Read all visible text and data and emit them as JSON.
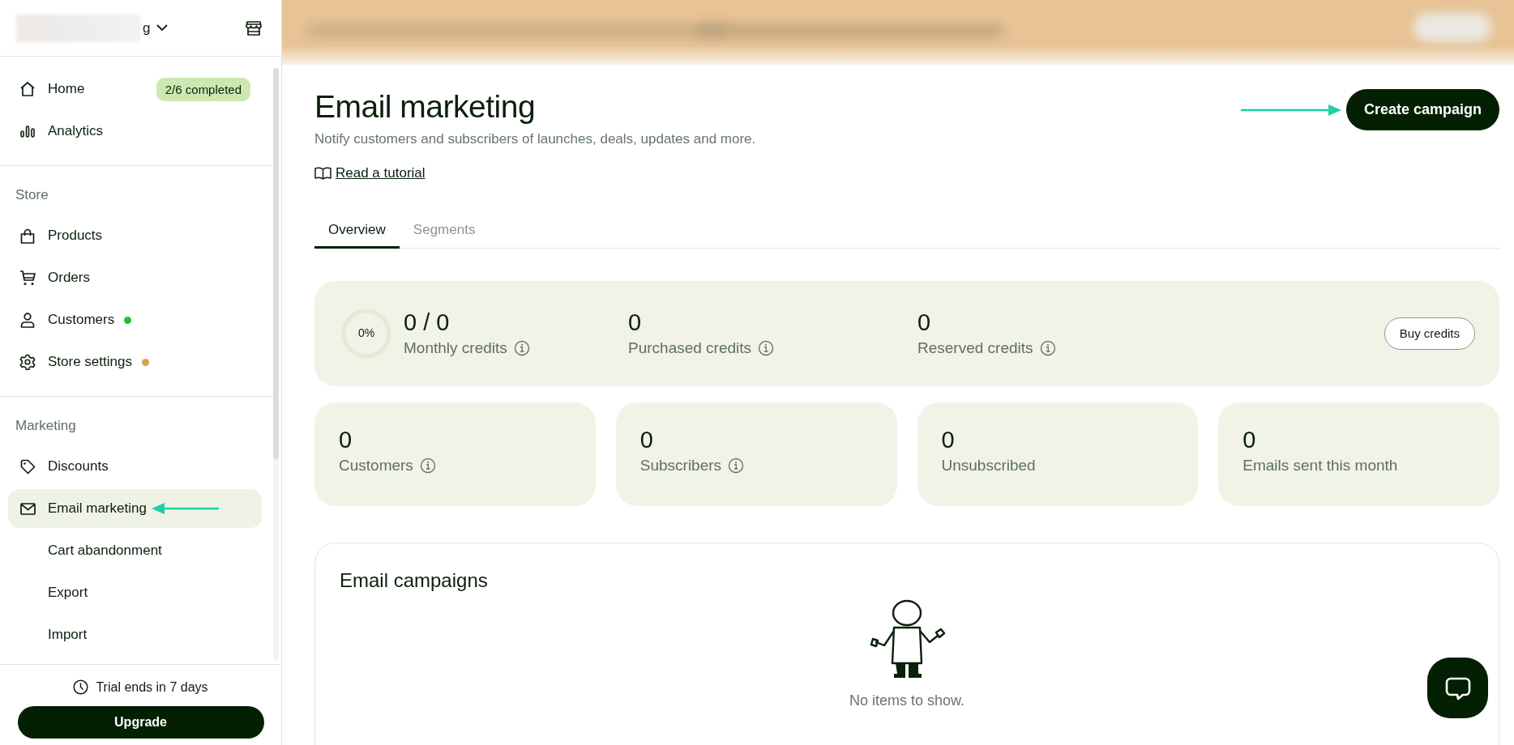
{
  "store_switcher": {
    "name_fragment": "g"
  },
  "sidebar": {
    "sections": [
      {
        "items": [
          {
            "label": "Home",
            "badge": "2/6 completed",
            "selected": false
          },
          {
            "label": "Analytics",
            "selected": false
          }
        ]
      },
      {
        "title": "Store",
        "items": [
          {
            "label": "Products",
            "selected": false
          },
          {
            "label": "Orders",
            "selected": false
          },
          {
            "label": "Customers",
            "color": "#22c03a",
            "selected": false
          },
          {
            "label": "Store settings",
            "color": "#d9a05b",
            "selected": false
          }
        ]
      },
      {
        "title": "Marketing",
        "items": [
          {
            "label": "Discounts",
            "selected": false
          },
          {
            "label": "Email marketing",
            "selected": true
          },
          {
            "label": "Cart abandonment",
            "kind": "sub",
            "selected": false
          },
          {
            "label": "Export",
            "kind": "sub",
            "selected": false
          },
          {
            "label": "Import",
            "kind": "sub",
            "selected": false
          }
        ]
      }
    ]
  },
  "sidebar_footer": {
    "trial": "Trial ends in 7 days",
    "upgrade": "Upgrade"
  },
  "page": {
    "title": "Email marketing",
    "subtitle": "Notify customers and subscribers of launches, deals, updates and more.",
    "tutorial_link": "Read a tutorial",
    "create_button": "Create campaign"
  },
  "tabs": [
    {
      "label": "Overview",
      "selected": true
    },
    {
      "label": "Segments",
      "selected": false
    }
  ],
  "credits": {
    "progress": {
      "label": "0%",
      "level": 0
    },
    "items": [
      {
        "value": "0 / 0",
        "label": "Monthly credits",
        "info": true
      },
      {
        "value": "0",
        "label": "Purchased credits",
        "info": true
      },
      {
        "value": "0",
        "label": "Reserved credits",
        "info": true
      }
    ],
    "button": "Buy credits"
  },
  "stats": [
    {
      "value": "0",
      "label": "Customers",
      "info": true
    },
    {
      "value": "0",
      "label": "Subscribers",
      "info": true
    },
    {
      "value": "0",
      "label": "Unsubscribed",
      "info": false
    },
    {
      "value": "0",
      "label": "Emails sent this month",
      "info": false
    }
  ],
  "campaigns": {
    "title": "Email campaigns",
    "empty_text": "No items to show."
  }
}
